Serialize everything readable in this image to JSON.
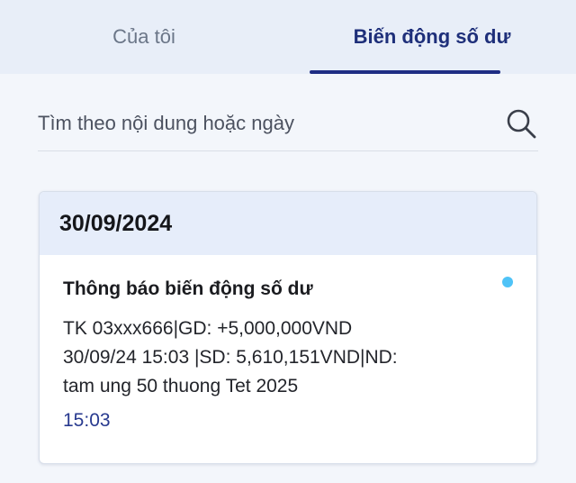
{
  "tabs": [
    {
      "label": "Của tôi",
      "active": false
    },
    {
      "label": "Biến động số dư",
      "active": true
    }
  ],
  "search": {
    "placeholder": "Tìm theo nội dung hoặc ngày",
    "icon": "search-icon"
  },
  "date_group": {
    "date": "30/09/2024",
    "notification": {
      "title": "Thông báo biến động số dư",
      "body_lines": [
        "TK 03xxx666|GD: +5,000,000VND",
        "30/09/24 15:03 |SD: 5,610,151VND|ND:",
        "tam ung 50 thuong Tet 2025"
      ],
      "time": "15:03",
      "unread": true
    }
  },
  "colors": {
    "accent": "#1f2e84",
    "unread_dot": "#4fc3f7",
    "header_bg": "#e8eef8"
  }
}
